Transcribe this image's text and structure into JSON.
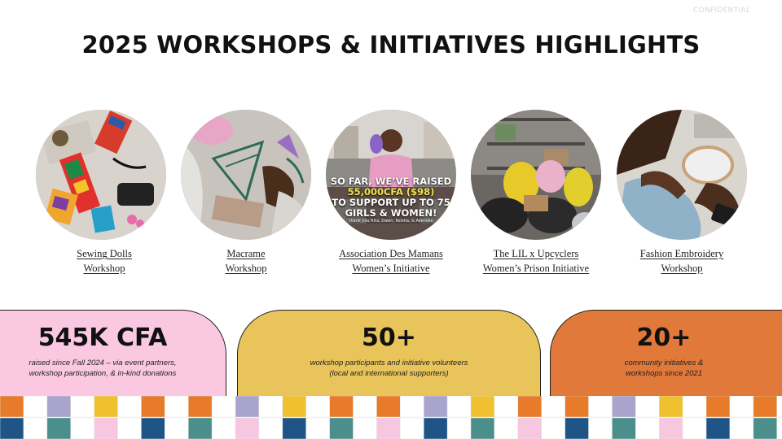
{
  "confidential_label": "CONFIDENTIAL",
  "title": "2025 WORKSHOPS & INITIATIVES HIGHLIGHTS",
  "workshops": [
    {
      "line1": "Sewing Dolls",
      "line2": "Workshop"
    },
    {
      "line1": "Macrame",
      "line2": "Workshop"
    },
    {
      "line1": "Association Des Mamans",
      "line2": "Women’s Initiative"
    },
    {
      "line1": "The LIL x Upcyclers",
      "line2": "Women’s Prison Initiative"
    },
    {
      "line1": "Fashion Embroidery",
      "line2": "Workshop"
    }
  ],
  "photo_overlay": {
    "line1": "SO FAR, WE’VE RAISED",
    "amount": "55,000CFA",
    "amount_usd": "($98)",
    "line2": "TO SUPPORT UP TO 75",
    "line3": "GIRLS & WOMEN!",
    "fine_print": "thank you Rita, Dawn, Keisha, & Avenwie"
  },
  "stats": [
    {
      "value": "545K CFA",
      "line1": "raised since Fall 2024 – via event partners,",
      "line2": "workshop participation, & in-kind donations",
      "color": "#fbc8e2"
    },
    {
      "value": "50+",
      "line1": "workshop participants and initiative volunteers",
      "line2": "(local and international supporters)",
      "color": "#e9c45a"
    },
    {
      "value": "20+",
      "line1": "community initiatives &",
      "line2": "workshops since 2021",
      "color": "#e0793a"
    }
  ],
  "palette": {
    "white": "#ffffff",
    "orange": "#e77b2a",
    "lavender": "#a9a4cc",
    "yellow": "#efc12f",
    "navy": "#1e5586",
    "teal": "#4a8f8b",
    "pink": "#f7c7e0"
  }
}
